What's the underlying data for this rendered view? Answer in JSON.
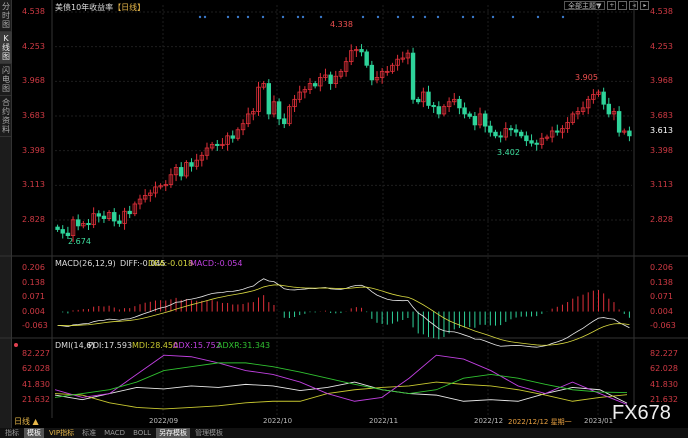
{
  "sidebar": {
    "items": [
      {
        "label": "分时图"
      },
      {
        "label": "K线图",
        "active": true
      },
      {
        "label": "闪电图"
      },
      {
        "label": "合约资料"
      }
    ]
  },
  "header": {
    "title": "美债10年收益率",
    "period": "【日线】",
    "theme_select": "全部主题▼",
    "icons": [
      "zoom-in-icon",
      "zoom-out-icon",
      "left-icon",
      "right-icon"
    ]
  },
  "colors": {
    "up": "#e0303a",
    "down": "#2ed39a",
    "axis": "#d03a44",
    "diff": "#e8e8e8",
    "dea": "#d8d840",
    "pdi": "#e8e8e8",
    "mdi": "#c8c830",
    "adx": "#c040e0",
    "adxr": "#30c030",
    "marker": "#3a78c8"
  },
  "chart_data": [
    {
      "type": "candlestick",
      "yticks": [
        "4.538",
        "4.253",
        "3.968",
        "3.683",
        "3.398",
        "3.113",
        "2.828"
      ],
      "ylim": [
        2.6,
        4.6
      ],
      "xticks": [
        "2022/09",
        "2022/10",
        "2022/11",
        "2022/12",
        "2023/01"
      ],
      "last_value": "3.613",
      "annotations": [
        {
          "text": "4.338",
          "value": 4.338
        },
        {
          "text": "3.905",
          "value": 3.905
        },
        {
          "text": "3.402",
          "value": 3.402
        },
        {
          "text": "2.674",
          "value": 2.674
        }
      ],
      "closes": [
        2.75,
        2.72,
        2.7,
        2.83,
        2.78,
        2.8,
        2.79,
        2.88,
        2.86,
        2.84,
        2.89,
        2.82,
        2.8,
        2.9,
        2.88,
        2.96,
        3.0,
        3.03,
        3.05,
        3.1,
        3.11,
        3.12,
        3.2,
        3.26,
        3.19,
        3.3,
        3.27,
        3.32,
        3.36,
        3.42,
        3.45,
        3.44,
        3.45,
        3.52,
        3.5,
        3.57,
        3.62,
        3.7,
        3.72,
        3.92,
        3.95,
        3.7,
        3.8,
        3.66,
        3.62,
        3.76,
        3.82,
        3.88,
        3.9,
        3.95,
        3.93,
        4.0,
        4.02,
        3.95,
        4.01,
        4.05,
        4.13,
        4.22,
        4.23,
        4.21,
        4.1,
        3.98,
        4.0,
        4.05,
        4.05,
        4.1,
        4.15,
        4.16,
        4.2,
        3.82,
        3.8,
        3.88,
        3.77,
        3.76,
        3.7,
        3.76,
        3.8,
        3.82,
        3.75,
        3.7,
        3.68,
        3.61,
        3.7,
        3.6,
        3.55,
        3.52,
        3.51,
        3.58,
        3.57,
        3.55,
        3.52,
        3.48,
        3.46,
        3.45,
        3.5,
        3.51,
        3.56,
        3.55,
        3.58,
        3.63,
        3.7,
        3.72,
        3.75,
        3.82,
        3.86,
        3.88,
        3.78,
        3.7,
        3.72,
        3.55,
        3.56,
        3.52
      ]
    },
    {
      "type": "macd",
      "title": "MACD(26,12,9)",
      "diff": "DIFF:-0.045",
      "dea": "DEA:-0.018",
      "macd": "MACD:-0.054",
      "yticks": [
        "0.206",
        "0.138",
        "0.071",
        "0.004",
        "-0.063"
      ],
      "ylim": [
        -0.09,
        0.23
      ]
    },
    {
      "type": "line",
      "title": "DMI(14,6)",
      "pdi_label": "PDI:17.593",
      "mdi_label": "MDI:28.450",
      "adx_label": "ADX:15.752",
      "adxr_label": "ADXR:31.343",
      "yticks": [
        "82.227",
        "62.028",
        "41.830",
        "21.632"
      ],
      "ylim": [
        10,
        90
      ],
      "series": [
        {
          "name": "PDI",
          "values": [
            28,
            22,
            30,
            38,
            36,
            40,
            38,
            42,
            40,
            34,
            38,
            45,
            35,
            30,
            28,
            20,
            22,
            20,
            30,
            38,
            35,
            17.6
          ]
        },
        {
          "name": "MDI",
          "values": [
            30,
            28,
            18,
            12,
            10,
            12,
            14,
            18,
            20,
            20,
            30,
            35,
            38,
            40,
            45,
            42,
            40,
            35,
            28,
            20,
            25,
            28.5
          ]
        },
        {
          "name": "ADX",
          "values": [
            35,
            25,
            30,
            55,
            80,
            78,
            70,
            60,
            55,
            45,
            30,
            20,
            25,
            50,
            80,
            75,
            60,
            40,
            30,
            45,
            30,
            15.8
          ]
        },
        {
          "name": "ADXR",
          "values": [
            25,
            30,
            35,
            45,
            60,
            65,
            70,
            70,
            65,
            58,
            50,
            42,
            35,
            30,
            35,
            50,
            55,
            50,
            42,
            35,
            32,
            31.3
          ]
        }
      ]
    }
  ],
  "axis": {
    "period_label": "日线 ▲",
    "cursor_date": "2022/12/12 星期一"
  },
  "tabs": [
    {
      "label": "指标"
    },
    {
      "label": "模板",
      "on": true
    },
    {
      "label": "VIP指标",
      "vip": true
    },
    {
      "label": "标准"
    },
    {
      "label": "MACD"
    },
    {
      "label": "BOLL"
    },
    {
      "label": "另存模板",
      "on": true
    },
    {
      "label": "管理模板"
    }
  ],
  "watermark": "FX678"
}
